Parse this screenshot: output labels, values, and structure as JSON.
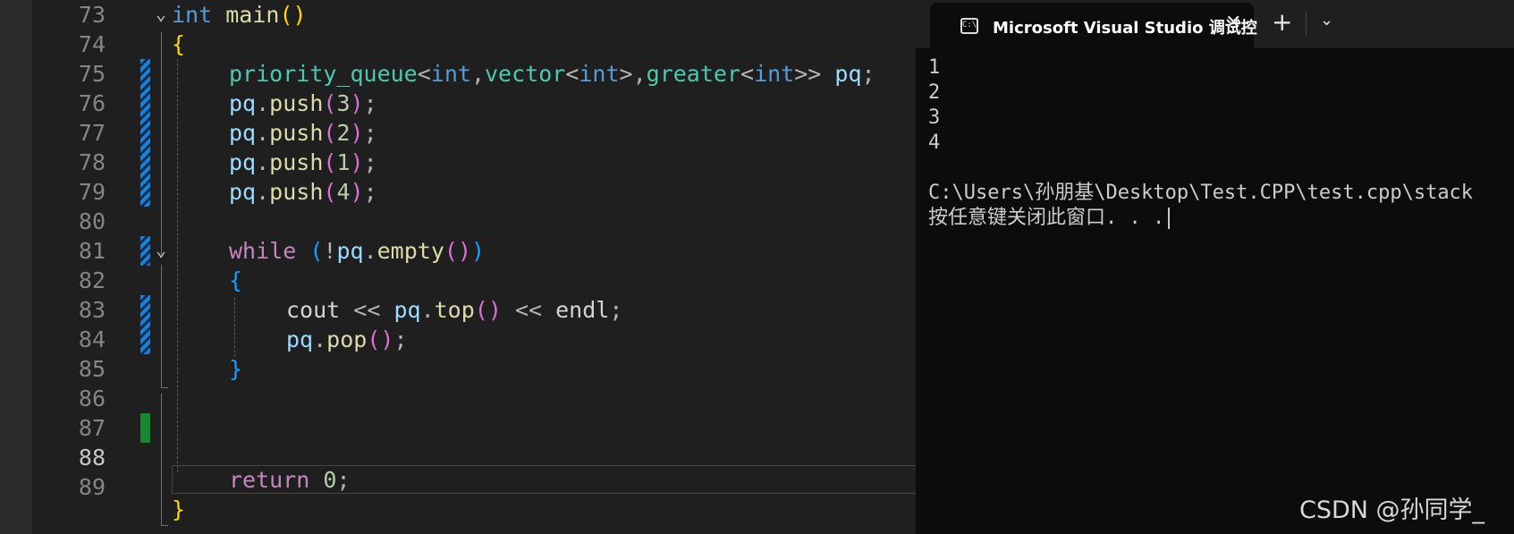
{
  "editor": {
    "line_numbers": [
      "73",
      "74",
      "75",
      "76",
      "77",
      "78",
      "79",
      "80",
      "81",
      "82",
      "83",
      "84",
      "85",
      "86",
      "87",
      "88",
      "89"
    ],
    "code": {
      "l73": {
        "kw": "int",
        "fn": "main",
        "paren": "()"
      },
      "l74": {
        "brace": "{"
      },
      "l75": {
        "type": "priority_queue",
        "lt": "<",
        "t1": "int",
        "comma1": ",",
        "type2": "vector",
        "lt2": "<",
        "t2": "int",
        "gt2": ">",
        "comma2": ",",
        "type3": "greater",
        "lt3": "<",
        "t3": "int",
        "gt3": ">>",
        "var": "pq",
        "semi": ";"
      },
      "push_calls": [
        {
          "var": "pq",
          "dot": ".",
          "fn": "push",
          "open": "(",
          "arg": "3",
          "close": ")",
          "semi": ";"
        },
        {
          "var": "pq",
          "dot": ".",
          "fn": "push",
          "open": "(",
          "arg": "2",
          "close": ")",
          "semi": ";"
        },
        {
          "var": "pq",
          "dot": ".",
          "fn": "push",
          "open": "(",
          "arg": "1",
          "close": ")",
          "semi": ";"
        },
        {
          "var": "pq",
          "dot": ".",
          "fn": "push",
          "open": "(",
          "arg": "4",
          "close": ")",
          "semi": ";"
        }
      ],
      "l81": {
        "kw": "while",
        "open": "(",
        "not": "!",
        "var": "pq",
        "dot": ".",
        "fn": "empty",
        "paren": "()",
        "close": ")"
      },
      "l82": {
        "brace": "{"
      },
      "l83": {
        "var1": "cout",
        "op1": "<<",
        "var2": "pq",
        "dot": ".",
        "fn": "top",
        "paren": "()",
        "op2": "<<",
        "var3": "endl",
        "semi": ";"
      },
      "l84": {
        "var": "pq",
        "dot": ".",
        "fn": "pop",
        "paren": "()",
        "semi": ";"
      },
      "l85": {
        "brace": "}"
      },
      "l88": {
        "kw": "return",
        "num": "0",
        "semi": ";"
      },
      "l89": {
        "brace": "}"
      }
    },
    "fold_glyph": "⌄"
  },
  "terminal": {
    "tab_icon_text": "C:\\",
    "tab_title": "Microsoft Visual Studio 调试控",
    "close_glyph": "✕",
    "new_tab_glyph": "+",
    "dropdown_glyph": "⌄",
    "output": [
      "1",
      "2",
      "3",
      "4",
      "",
      "C:\\Users\\孙朋基\\Desktop\\Test.CPP\\test.cpp\\stack",
      "按任意键关闭此窗口. . ."
    ]
  },
  "watermark": "CSDN @孙同学_",
  "colors": {
    "change_bar": "#1b80d8",
    "saved_bar": "#15892b",
    "editor_bg": "#1f1f1f",
    "terminal_bg": "#0c0c0c"
  }
}
